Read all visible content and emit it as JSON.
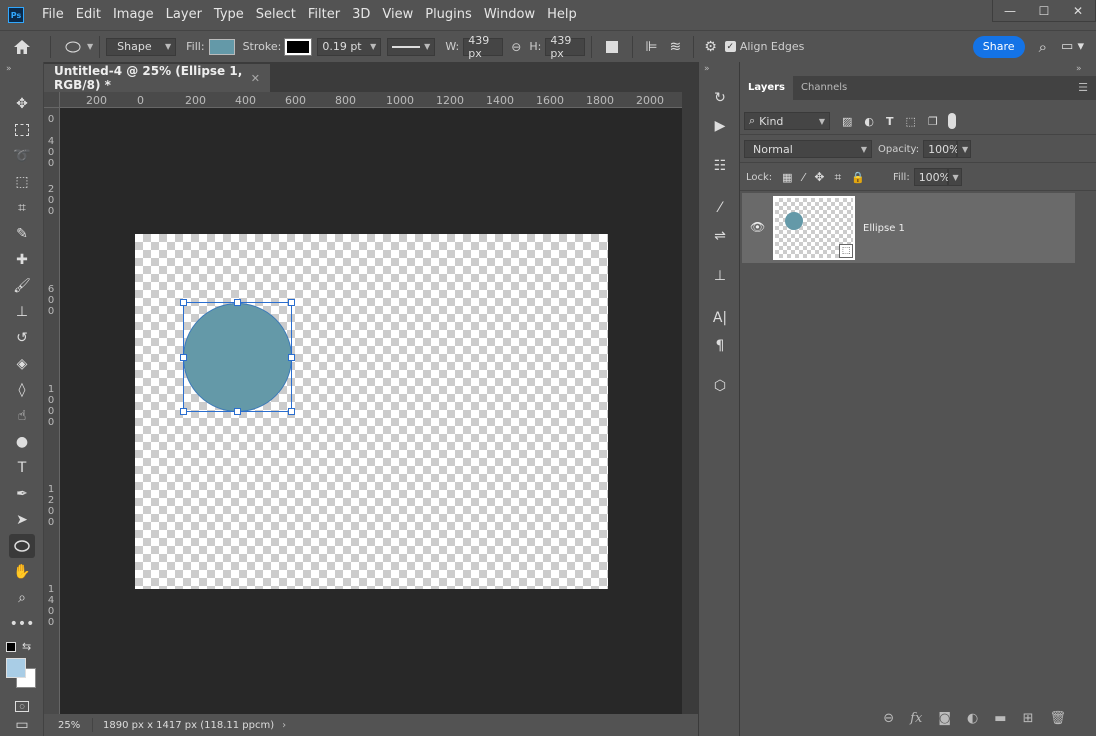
{
  "app": {
    "logo": "Ps"
  },
  "menu": [
    "File",
    "Edit",
    "Image",
    "Layer",
    "Type",
    "Select",
    "Filter",
    "3D",
    "View",
    "Plugins",
    "Window",
    "Help"
  ],
  "window_controls": {
    "minimize": "—",
    "maximize": "☐",
    "close": "✕"
  },
  "options": {
    "mode": "Shape",
    "fill_label": "Fill:",
    "fill_color": "#6499a8",
    "stroke_label": "Stroke:",
    "stroke_width": "0.19 pt",
    "w_label": "W:",
    "w_value": "439 px",
    "h_label": "H:",
    "h_value": "439 px",
    "align_edges": "Align Edges",
    "share": "Share"
  },
  "document": {
    "tab_title": "Untitled-4 @ 25% (Ellipse 1, RGB/8) *",
    "zoom": "25%",
    "dimensions": "1890 px x 1417 px (118.11 ppcm)"
  },
  "ruler": {
    "top": [
      "200",
      "0",
      "200",
      "400",
      "600",
      "800",
      "1000",
      "1200",
      "1400",
      "1600",
      "1800",
      "2000"
    ],
    "left": [
      "0",
      "400",
      "200",
      "600",
      "1000",
      "1200",
      "1400"
    ]
  },
  "panel": {
    "tabs": [
      "Layers",
      "Channels"
    ],
    "filter_kind": "Kind",
    "blend_mode": "Normal",
    "opacity_label": "Opacity:",
    "opacity": "100%",
    "lock_label": "Lock:",
    "fill_label": "Fill:",
    "fill": "100%",
    "layers": [
      {
        "name": "Ellipse 1",
        "visible": true
      }
    ]
  },
  "colors": {
    "accent": "#1473e6",
    "shape_fill": "#6499a8",
    "selection": "#2a6ecf"
  }
}
